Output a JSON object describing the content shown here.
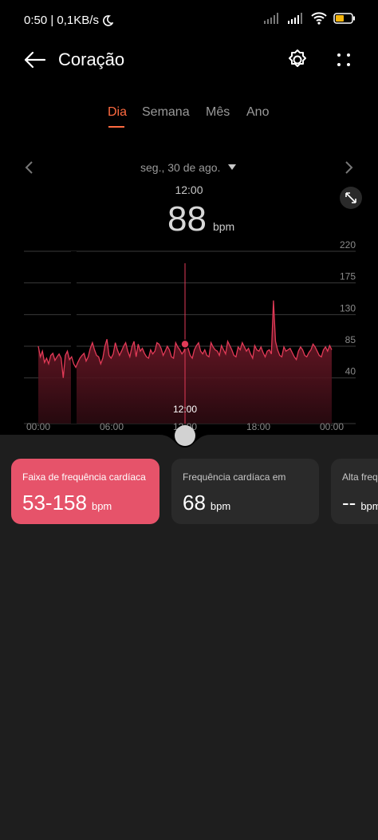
{
  "status": {
    "time_speed": "0:50 | 0,1KB/s",
    "battery_color": "#f5b50c"
  },
  "header": {
    "title": "Coração",
    "back_icon": "arrow-left-icon",
    "settings_icon": "gear-icon",
    "more_icon": "more-dots-icon"
  },
  "tabs": [
    {
      "label": "Dia",
      "active": true
    },
    {
      "label": "Semana"
    },
    {
      "label": "Mês"
    },
    {
      "label": "Ano"
    }
  ],
  "date": {
    "label": "seg., 30 de ago."
  },
  "readout": {
    "time": "12:00",
    "value": "88",
    "unit": "bpm"
  },
  "colors": {
    "accent": "#ff6a40",
    "series": "#e23a57",
    "card_selected": "#e6536a"
  },
  "chart_data": {
    "type": "line",
    "x_ticks": [
      "00:00",
      "06:00",
      "12:00",
      "18:00",
      "00:00"
    ],
    "y_ticks": [
      40,
      85,
      130,
      175,
      220
    ],
    "ylim": [
      0,
      220
    ],
    "cursor_label": "12:00",
    "cursor_value": 88,
    "series": [
      {
        "values": [
          85,
          70,
          78,
          62,
          68,
          60,
          72,
          75,
          65,
          70,
          74,
          68,
          40,
          72,
          78,
          66,
          70,
          60,
          55,
          62,
          68,
          72,
          75,
          64,
          70,
          82,
          90,
          80,
          72,
          70,
          60,
          68,
          85,
          95,
          72,
          68,
          74,
          90,
          80,
          72,
          78,
          85,
          90,
          78,
          70,
          84,
          92,
          70,
          88,
          78,
          82,
          75,
          70,
          68,
          80,
          74,
          78,
          90,
          88,
          82,
          72,
          78,
          85,
          80,
          70,
          68,
          90,
          84,
          80,
          74,
          78,
          88,
          82,
          72,
          68,
          80,
          86,
          90,
          78,
          74,
          80,
          72,
          70,
          90,
          84,
          80,
          78,
          72,
          86,
          80,
          74,
          92,
          86,
          80,
          72,
          70,
          84,
          80,
          90,
          84,
          78,
          82,
          74,
          68,
          86,
          80,
          78,
          84,
          76,
          70,
          78,
          80,
          74,
          150,
          92,
          80,
          72,
          70,
          84,
          78,
          80,
          82,
          76,
          70,
          66,
          78,
          84,
          80,
          72,
          70,
          76,
          80,
          88,
          84,
          78,
          72,
          70,
          80,
          84,
          78,
          86,
          80
        ]
      }
    ]
  },
  "cards": [
    {
      "label": "Faixa de frequência cardíaca",
      "value": "53-158",
      "unit": "bpm",
      "selected": true
    },
    {
      "label": "Frequência cardíaca em",
      "value": "68",
      "unit": "bpm"
    },
    {
      "label": "Alta freq",
      "value": "--",
      "unit": "bpm"
    }
  ]
}
